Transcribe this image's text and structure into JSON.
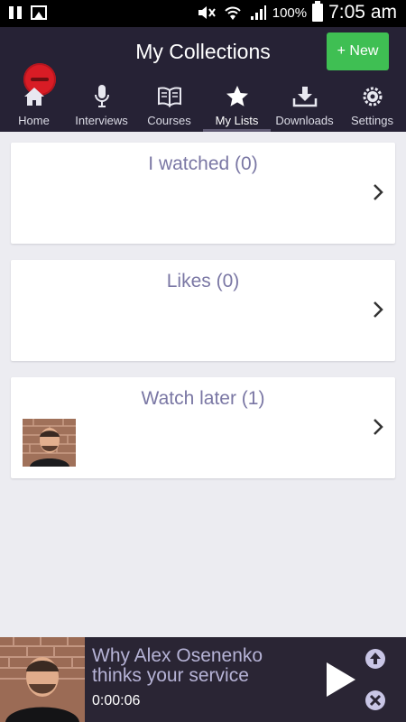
{
  "status_bar": {
    "battery": "100%",
    "time": "7:05 am"
  },
  "header": {
    "title": "My Collections",
    "new_button": "+ New"
  },
  "tabs": [
    {
      "label": "Home",
      "icon": "home-icon"
    },
    {
      "label": "Interviews",
      "icon": "microphone-icon"
    },
    {
      "label": "Courses",
      "icon": "book-icon"
    },
    {
      "label": "My Lists",
      "icon": "star-icon",
      "active": true
    },
    {
      "label": "Downloads",
      "icon": "download-icon"
    },
    {
      "label": "Settings",
      "icon": "gear-icon"
    }
  ],
  "lists": [
    {
      "title": "I watched (0)"
    },
    {
      "title": "Likes (0)"
    },
    {
      "title": "Watch later (1)"
    }
  ],
  "player": {
    "title": "Why Alex Osenenko thinks your service",
    "time": "0:00:06"
  },
  "colors": {
    "header_bg": "#262235",
    "accent_new": "#3fbf53",
    "card_title": "#7a77a4",
    "player_title": "#b6b3d6",
    "remove_button": "#d81c25"
  }
}
